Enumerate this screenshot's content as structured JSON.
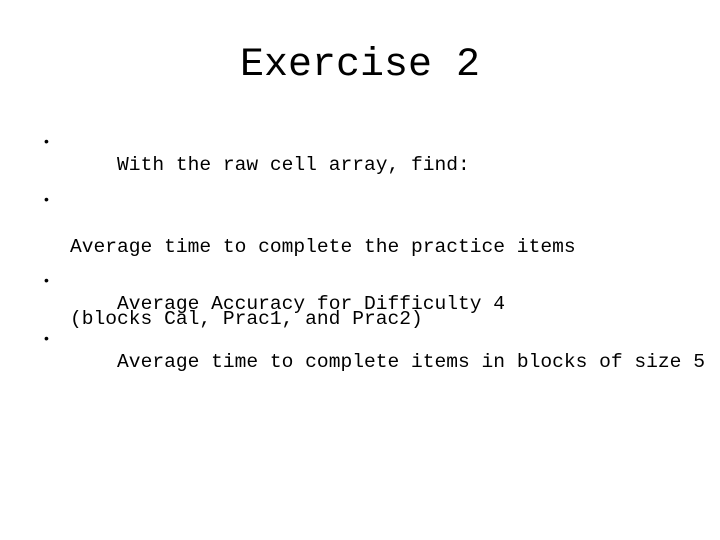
{
  "slide": {
    "title": "Exercise 2",
    "bullet_glyph": "•",
    "bullets": [
      {
        "lines": [
          "With the raw cell array, find:"
        ]
      },
      {
        "lines": [
          "Average time to complete the practice items",
          "(blocks Cal, Prac1, and Prac2)"
        ]
      },
      {
        "lines": [
          "Average Accuracy for Difficulty 4"
        ]
      },
      {
        "lines": [
          "Average time to complete items in blocks of size 5"
        ]
      }
    ]
  }
}
